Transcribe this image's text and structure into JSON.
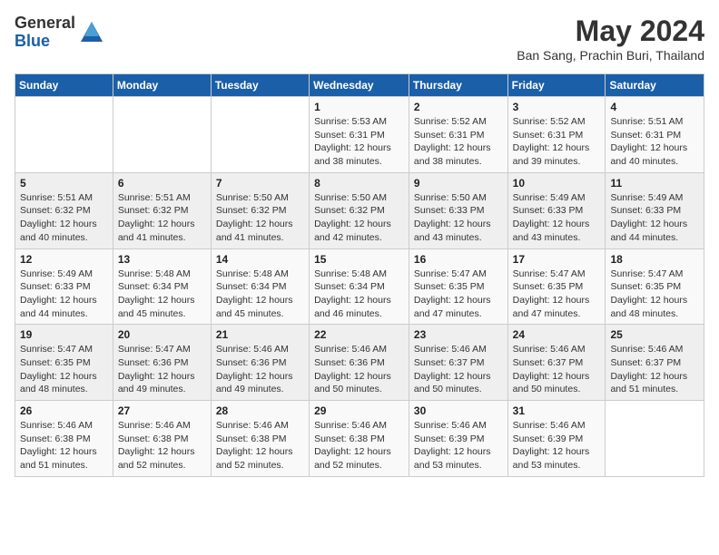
{
  "logo": {
    "general": "General",
    "blue": "Blue"
  },
  "title": {
    "month_year": "May 2024",
    "location": "Ban Sang, Prachin Buri, Thailand"
  },
  "days_of_week": [
    "Sunday",
    "Monday",
    "Tuesday",
    "Wednesday",
    "Thursday",
    "Friday",
    "Saturday"
  ],
  "weeks": [
    [
      {
        "day": "",
        "info": ""
      },
      {
        "day": "",
        "info": ""
      },
      {
        "day": "",
        "info": ""
      },
      {
        "day": "1",
        "info": "Sunrise: 5:53 AM\nSunset: 6:31 PM\nDaylight: 12 hours\nand 38 minutes."
      },
      {
        "day": "2",
        "info": "Sunrise: 5:52 AM\nSunset: 6:31 PM\nDaylight: 12 hours\nand 38 minutes."
      },
      {
        "day": "3",
        "info": "Sunrise: 5:52 AM\nSunset: 6:31 PM\nDaylight: 12 hours\nand 39 minutes."
      },
      {
        "day": "4",
        "info": "Sunrise: 5:51 AM\nSunset: 6:31 PM\nDaylight: 12 hours\nand 40 minutes."
      }
    ],
    [
      {
        "day": "5",
        "info": "Sunrise: 5:51 AM\nSunset: 6:32 PM\nDaylight: 12 hours\nand 40 minutes."
      },
      {
        "day": "6",
        "info": "Sunrise: 5:51 AM\nSunset: 6:32 PM\nDaylight: 12 hours\nand 41 minutes."
      },
      {
        "day": "7",
        "info": "Sunrise: 5:50 AM\nSunset: 6:32 PM\nDaylight: 12 hours\nand 41 minutes."
      },
      {
        "day": "8",
        "info": "Sunrise: 5:50 AM\nSunset: 6:32 PM\nDaylight: 12 hours\nand 42 minutes."
      },
      {
        "day": "9",
        "info": "Sunrise: 5:50 AM\nSunset: 6:33 PM\nDaylight: 12 hours\nand 43 minutes."
      },
      {
        "day": "10",
        "info": "Sunrise: 5:49 AM\nSunset: 6:33 PM\nDaylight: 12 hours\nand 43 minutes."
      },
      {
        "day": "11",
        "info": "Sunrise: 5:49 AM\nSunset: 6:33 PM\nDaylight: 12 hours\nand 44 minutes."
      }
    ],
    [
      {
        "day": "12",
        "info": "Sunrise: 5:49 AM\nSunset: 6:33 PM\nDaylight: 12 hours\nand 44 minutes."
      },
      {
        "day": "13",
        "info": "Sunrise: 5:48 AM\nSunset: 6:34 PM\nDaylight: 12 hours\nand 45 minutes."
      },
      {
        "day": "14",
        "info": "Sunrise: 5:48 AM\nSunset: 6:34 PM\nDaylight: 12 hours\nand 45 minutes."
      },
      {
        "day": "15",
        "info": "Sunrise: 5:48 AM\nSunset: 6:34 PM\nDaylight: 12 hours\nand 46 minutes."
      },
      {
        "day": "16",
        "info": "Sunrise: 5:47 AM\nSunset: 6:35 PM\nDaylight: 12 hours\nand 47 minutes."
      },
      {
        "day": "17",
        "info": "Sunrise: 5:47 AM\nSunset: 6:35 PM\nDaylight: 12 hours\nand 47 minutes."
      },
      {
        "day": "18",
        "info": "Sunrise: 5:47 AM\nSunset: 6:35 PM\nDaylight: 12 hours\nand 48 minutes."
      }
    ],
    [
      {
        "day": "19",
        "info": "Sunrise: 5:47 AM\nSunset: 6:35 PM\nDaylight: 12 hours\nand 48 minutes."
      },
      {
        "day": "20",
        "info": "Sunrise: 5:47 AM\nSunset: 6:36 PM\nDaylight: 12 hours\nand 49 minutes."
      },
      {
        "day": "21",
        "info": "Sunrise: 5:46 AM\nSunset: 6:36 PM\nDaylight: 12 hours\nand 49 minutes."
      },
      {
        "day": "22",
        "info": "Sunrise: 5:46 AM\nSunset: 6:36 PM\nDaylight: 12 hours\nand 50 minutes."
      },
      {
        "day": "23",
        "info": "Sunrise: 5:46 AM\nSunset: 6:37 PM\nDaylight: 12 hours\nand 50 minutes."
      },
      {
        "day": "24",
        "info": "Sunrise: 5:46 AM\nSunset: 6:37 PM\nDaylight: 12 hours\nand 50 minutes."
      },
      {
        "day": "25",
        "info": "Sunrise: 5:46 AM\nSunset: 6:37 PM\nDaylight: 12 hours\nand 51 minutes."
      }
    ],
    [
      {
        "day": "26",
        "info": "Sunrise: 5:46 AM\nSunset: 6:38 PM\nDaylight: 12 hours\nand 51 minutes."
      },
      {
        "day": "27",
        "info": "Sunrise: 5:46 AM\nSunset: 6:38 PM\nDaylight: 12 hours\nand 52 minutes."
      },
      {
        "day": "28",
        "info": "Sunrise: 5:46 AM\nSunset: 6:38 PM\nDaylight: 12 hours\nand 52 minutes."
      },
      {
        "day": "29",
        "info": "Sunrise: 5:46 AM\nSunset: 6:38 PM\nDaylight: 12 hours\nand 52 minutes."
      },
      {
        "day": "30",
        "info": "Sunrise: 5:46 AM\nSunset: 6:39 PM\nDaylight: 12 hours\nand 53 minutes."
      },
      {
        "day": "31",
        "info": "Sunrise: 5:46 AM\nSunset: 6:39 PM\nDaylight: 12 hours\nand 53 minutes."
      },
      {
        "day": "",
        "info": ""
      }
    ]
  ]
}
